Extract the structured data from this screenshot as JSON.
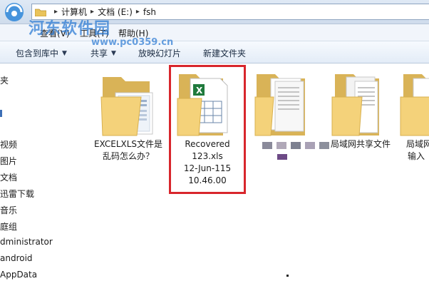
{
  "address_bar": {
    "crumbs": [
      "计算机",
      "文档 (E:)",
      "fsh"
    ],
    "separator": "▸"
  },
  "menu": {
    "items": [
      "查看(V)",
      "工具(T)",
      "帮助(H)"
    ]
  },
  "toolbar": {
    "include_in_library": "包含到库中",
    "share": "共享",
    "slideshow": "放映幻灯片",
    "new_folder": "新建文件夹",
    "caret": "▼"
  },
  "watermark": {
    "title": "河东软件园",
    "url": "www.pc0359.cn"
  },
  "sidebar": {
    "items": [
      "夹",
      "视频",
      "图片",
      "文档",
      "迅雷下载",
      "音乐",
      "庭组",
      "dministrator",
      "android",
      "AppData"
    ]
  },
  "files": [
    {
      "name_line1": "EXCELXLS文件是",
      "name_line2": "乱码怎么办？"
    },
    {
      "name_line1": "Recovered",
      "name_line2": "123.xls",
      "name_line3": "12-Jun-115",
      "name_line4": "10.46.00"
    },
    {
      "name_line1": ""
    },
    {
      "name_line1": "局域网共享文件"
    },
    {
      "name_line1": "局域网",
      "name_line2": "输入"
    }
  ],
  "colors": {
    "selection_border": "#d8262c",
    "folder_yellow": "#f2d27a",
    "watermark_blue": "#2878d2"
  }
}
